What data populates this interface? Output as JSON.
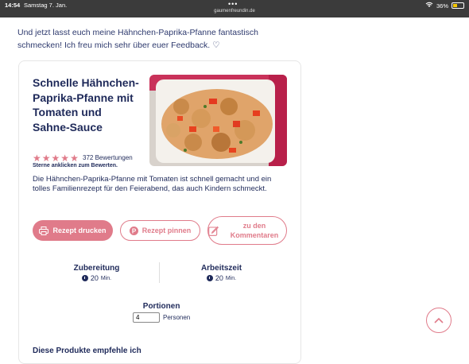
{
  "status_bar": {
    "time": "14:54",
    "date": "Samstag 7. Jan.",
    "url": "gaumenfreundin.de",
    "battery": "36%"
  },
  "intro_text": "Und jetzt lasst euch meine Hähnchen-Paprika-Pfanne fantastisch schmecken! Ich freu mich sehr über euer Feedback. ♡",
  "recipe": {
    "title": "Schnelle Hähnchen-Paprika-Pfanne mit Tomaten und Sahne-Sauce",
    "rating": {
      "stars": 5,
      "count_text": "372 Bewertungen",
      "hint": "Sterne anklicken zum Bewerten."
    },
    "description": "Die Hähnchen-Paprika-Pfanne mit Tomaten ist schnell gemacht und ein tolles Familienrezept für den Feierabend, das auch Kindern schmeckt.",
    "buttons": {
      "print": "Rezept drucken",
      "pin": "Rezept pinnen",
      "comment": "zu den Kommentaren"
    },
    "prep": {
      "label": "Zubereitung",
      "value": "20",
      "unit": "Min."
    },
    "work": {
      "label": "Arbeitszeit",
      "value": "20",
      "unit": "Min."
    },
    "portions": {
      "label": "Portionen",
      "value": "4",
      "unit": "Personen"
    },
    "bottom_partial": "Diese Produkte empfehle ich"
  },
  "colors": {
    "accent": "#e07b8a",
    "navy": "#1f2a5a"
  }
}
